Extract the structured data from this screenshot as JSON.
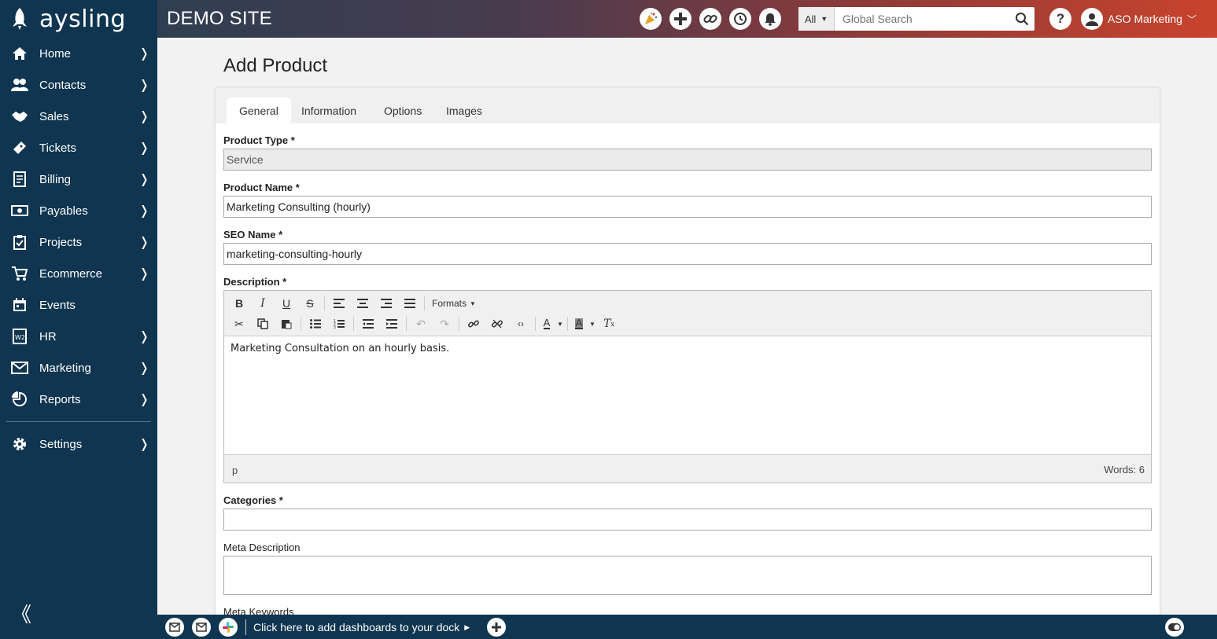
{
  "brand": {
    "name": "aysling"
  },
  "sidebar": {
    "items": [
      {
        "label": "Home",
        "icon": "home-icon",
        "chevron": true
      },
      {
        "label": "Contacts",
        "icon": "contacts-icon",
        "chevron": true
      },
      {
        "label": "Sales",
        "icon": "handshake-icon",
        "chevron": true
      },
      {
        "label": "Tickets",
        "icon": "ticket-icon",
        "chevron": true
      },
      {
        "label": "Billing",
        "icon": "invoice-icon",
        "chevron": true
      },
      {
        "label": "Payables",
        "icon": "money-icon",
        "chevron": true
      },
      {
        "label": "Projects",
        "icon": "clipboard-icon",
        "chevron": true
      },
      {
        "label": "Ecommerce",
        "icon": "cart-icon",
        "chevron": true
      },
      {
        "label": "Events",
        "icon": "calendar-icon",
        "chevron": false
      },
      {
        "label": "HR",
        "icon": "w2-form-icon",
        "chevron": true
      },
      {
        "label": "Marketing",
        "icon": "envelope-icon",
        "chevron": true
      },
      {
        "label": "Reports",
        "icon": "chart-icon",
        "chevron": true
      }
    ],
    "settings": {
      "label": "Settings",
      "icon": "gear-icon"
    },
    "collapse_glyph": "《"
  },
  "topbar": {
    "site_title": "DEMO SITE",
    "search": {
      "scope": "All",
      "placeholder": "Global Search"
    },
    "help_glyph": "?",
    "user_name": "ASO Marketing"
  },
  "page": {
    "title": "Add Product",
    "tabs": [
      "General",
      "Information",
      "Options",
      "Images"
    ],
    "active_tab": "General"
  },
  "form": {
    "product_type": {
      "label": "Product Type *",
      "value": "Service"
    },
    "product_name": {
      "label": "Product Name *",
      "value": "Marketing Consulting (hourly)"
    },
    "seo_name": {
      "label": "SEO Name *",
      "value": "marketing-consulting-hourly"
    },
    "description": {
      "label": "Description *",
      "formats_label": "Formats",
      "content": "Marketing Consultation on an hourly basis.",
      "path": "p",
      "words": "Words: 6"
    },
    "categories": {
      "label": "Categories *",
      "value": ""
    },
    "meta_description": {
      "label": "Meta Description",
      "value": ""
    },
    "meta_keywords": {
      "label": "Meta Keywords"
    }
  },
  "dock": {
    "text": "Click here to add dashboards to your dock"
  },
  "colors": {
    "sidebar": "#0f3550",
    "topbar_start": "#2f3e52",
    "topbar_end": "#c9432c"
  }
}
